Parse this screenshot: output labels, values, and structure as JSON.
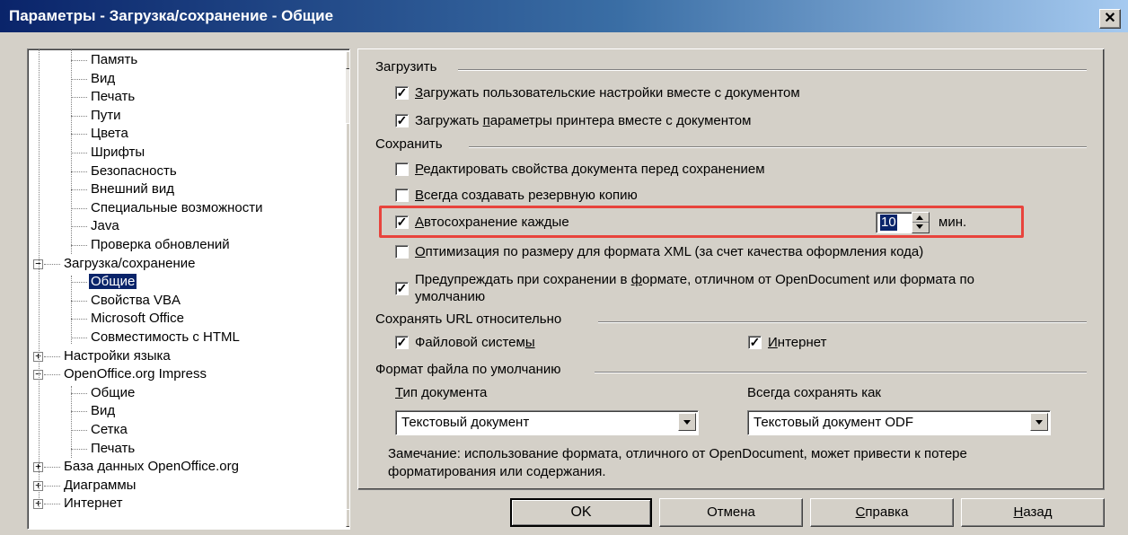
{
  "window": {
    "title": "Параметры - Загрузка/сохранение - Общие",
    "close_glyph": "✕"
  },
  "tree": {
    "items": [
      {
        "label": "Память"
      },
      {
        "label": "Вид"
      },
      {
        "label": "Печать"
      },
      {
        "label": "Пути"
      },
      {
        "label": "Цвета"
      },
      {
        "label": "Шрифты"
      },
      {
        "label": "Безопасность"
      },
      {
        "label": "Внешний вид"
      },
      {
        "label": "Специальные возможности"
      },
      {
        "label": "Java"
      },
      {
        "label": "Проверка обновлений"
      },
      {
        "label": "Загрузка/сохранение",
        "expander": "−"
      },
      {
        "label": "Общие",
        "selected": true
      },
      {
        "label": "Свойства VBA"
      },
      {
        "label": "Microsoft Office"
      },
      {
        "label": "Совместимость с HTML"
      },
      {
        "label": "Настройки языка",
        "expander": "+"
      },
      {
        "label": "OpenOffice.org Impress",
        "expander": "−"
      },
      {
        "label": "Общие"
      },
      {
        "label": "Вид"
      },
      {
        "label": "Сетка"
      },
      {
        "label": "Печать"
      },
      {
        "label": "База данных OpenOffice.org",
        "expander": "+"
      },
      {
        "label": "Диаграммы",
        "expander": "+"
      },
      {
        "label": "Интернет",
        "expander": "+"
      }
    ]
  },
  "load": {
    "header": "Загрузить",
    "user_settings": {
      "pre": "",
      "u": "З",
      "post": "агружать пользовательские настройки вместе с документом",
      "checked": true
    },
    "printer_settings": {
      "pre": "Загружать ",
      "u": "п",
      "post": "араметры принтера вместе с документом",
      "checked": true
    }
  },
  "save": {
    "header": "Сохранить",
    "edit_props": {
      "pre": "",
      "u": "Р",
      "post": "едактировать свойства документа перед сохранением",
      "checked": false
    },
    "backup": {
      "pre": "",
      "u": "В",
      "post": "сегда создавать резервную копию",
      "checked": false
    },
    "autosave": {
      "pre": "",
      "u": "А",
      "post": "втосохранение каждые",
      "checked": true,
      "value": "10",
      "unit": "мин."
    },
    "xml_size": {
      "pre": "",
      "u": "О",
      "post": "птимизация по размеру для формата XML (за счет качества оформления кода)",
      "checked": false
    },
    "warn_line1": {
      "pre": "Предупреждать при сохранении в ",
      "u": "ф",
      "post": "ормате, отличном от OpenDocument или формата по"
    },
    "warn_line2": "умолчанию",
    "warn_checked": true
  },
  "url": {
    "header": "Сохранять URL относительно",
    "fs": {
      "pre": "Файловой систем",
      "u": "ы",
      "post": "",
      "checked": true
    },
    "inet": {
      "pre": "",
      "u": "И",
      "post": "нтернет",
      "checked": true
    }
  },
  "format": {
    "header": "Формат файла по умолчанию",
    "doctype_label": {
      "pre": "",
      "u": "Т",
      "post": "ип документа"
    },
    "doctype_value": "Текстовый документ",
    "saveas_label": "Всегда сохранять как",
    "saveas_value": "Текстовый документ ODF",
    "note_line1": "Замечание: использование формата, отличного от OpenDocument, может привести к потере",
    "note_line2": "форматирования или содержания."
  },
  "buttons": {
    "ok": "OK",
    "cancel": "Отмена",
    "help": {
      "pre": "",
      "u": "С",
      "post": "правка"
    },
    "back": {
      "pre": "",
      "u": "Н",
      "post": "азад"
    }
  }
}
